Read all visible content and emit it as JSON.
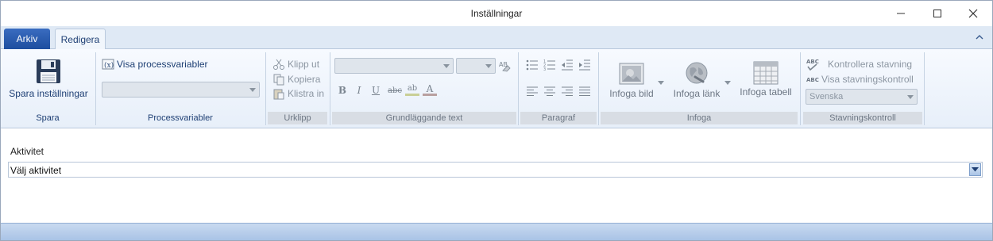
{
  "window": {
    "title": "Inställningar",
    "controls": [
      "minimize-icon",
      "maximize-icon",
      "close-icon"
    ]
  },
  "tabs": {
    "file": "Arkiv",
    "edit": "Redigera"
  },
  "ribbon": {
    "spara": {
      "button": "Spara inställningar",
      "group": "Spara"
    },
    "processvariabler": {
      "toggle": "Visa processvariabler",
      "combo_value": "",
      "group": "Processvariabler"
    },
    "urklipp": {
      "cut": "Klipp ut",
      "copy": "Kopiera",
      "paste": "Klistra in",
      "group": "Urklipp"
    },
    "text": {
      "font_value": "",
      "size_value": "",
      "bold": "B",
      "italic": "I",
      "underline": "U",
      "strike": "abc",
      "highlight": "ab",
      "color": "A",
      "group": "Grundläggande text"
    },
    "paragraf": {
      "group": "Paragraf"
    },
    "infoga": {
      "image": "Infoga bild",
      "link": "Infoga länk",
      "table": "Infoga tabell",
      "group": "Infoga"
    },
    "stavning": {
      "check": "Kontrollera stavning",
      "show": "Visa stavningskontroll",
      "language": "Svenska",
      "group": "Stavningskontroll"
    }
  },
  "form": {
    "label": "Aktivitet",
    "select_value": "Välj aktivitet"
  },
  "colors": {
    "accent": "#1d4e9f",
    "ribbon_bg": "#e7eff9",
    "tabbar_bg": "#dfe9f5",
    "statusbar": "#a9c3e6"
  }
}
